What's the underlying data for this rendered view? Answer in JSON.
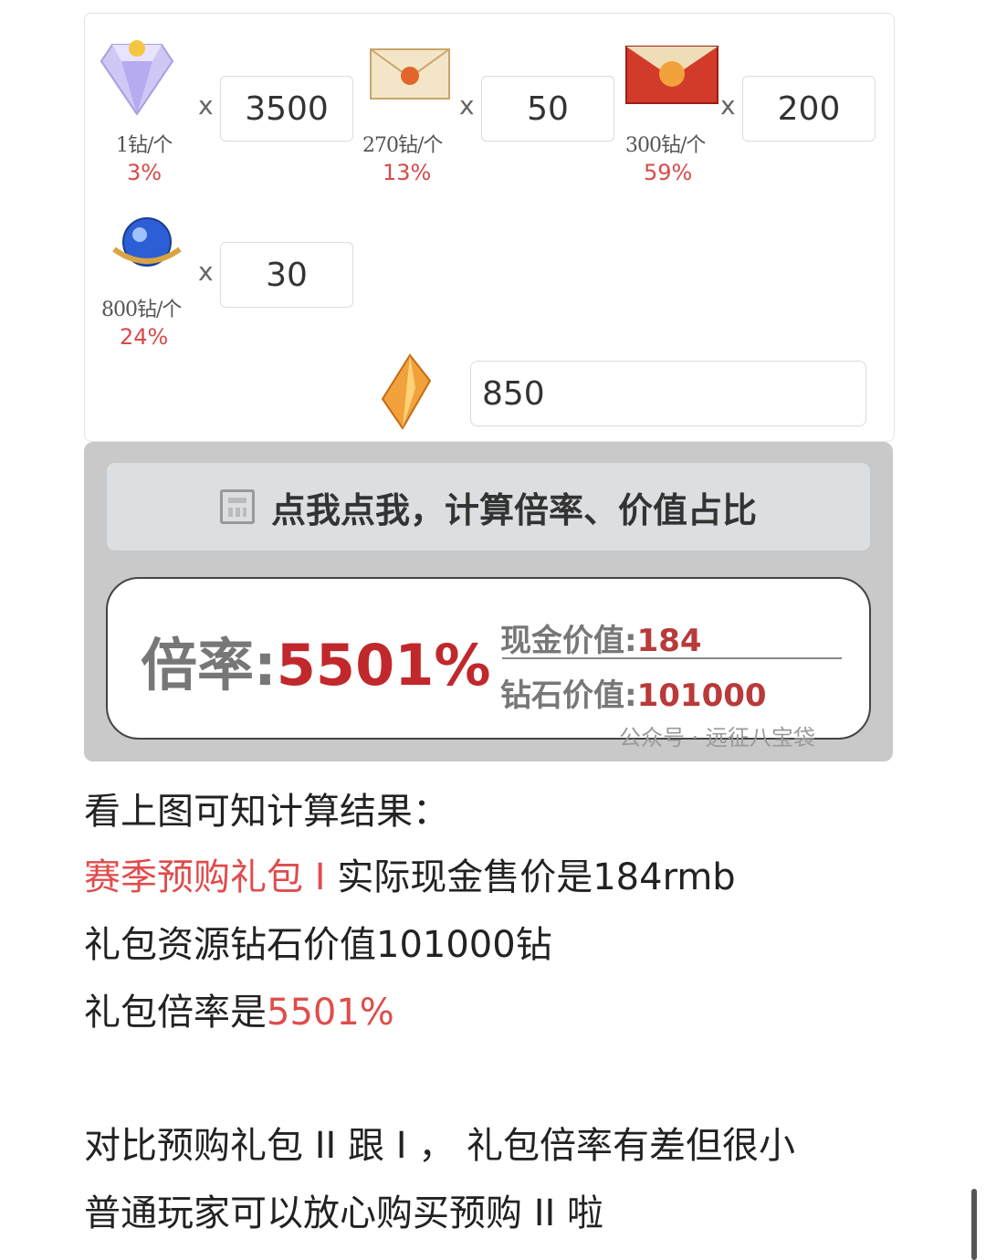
{
  "calculator": {
    "items": [
      {
        "name": "diamond",
        "price": "1钻/个",
        "percent": "3%",
        "quantity": "3500",
        "times": "x"
      },
      {
        "name": "envelope",
        "price": "270钻/个",
        "percent": "13%",
        "quantity": "50",
        "times": "x"
      },
      {
        "name": "red-chest",
        "price": "300钻/个",
        "percent": "59%",
        "quantity": "200",
        "times": "x"
      },
      {
        "name": "blue-orb",
        "price": "800钻/个",
        "percent": "24%",
        "quantity": "30",
        "times": "x"
      }
    ],
    "rmb_value": "850"
  },
  "result": {
    "button_label": "点我点我，计算倍率、价值占比",
    "rate_label": "倍率:",
    "rate_value": "5501%",
    "cash_label": "现金价值:",
    "cash_value": "184",
    "diamond_label": "钻石价值:",
    "diamond_value": "101000",
    "watermark": "公众号 · 远征八宝袋"
  },
  "article": {
    "line1": "看上图可知计算结果：",
    "line2_highlight": "赛季预购礼包 I",
    "line2_rest": " 实际现金售价是184rmb",
    "line3": "礼包资源钻石价值101000钻",
    "line4_prefix": "礼包倍率是",
    "line4_highlight": "5501%",
    "line5": "对比预购礼包 II 跟 I ， 礼包倍率有差但很小",
    "line6": "普通玩家可以放心购买预购 II 啦"
  },
  "colors": {
    "accent_red": "#e04c4c",
    "rate_red": "#c0282c"
  }
}
